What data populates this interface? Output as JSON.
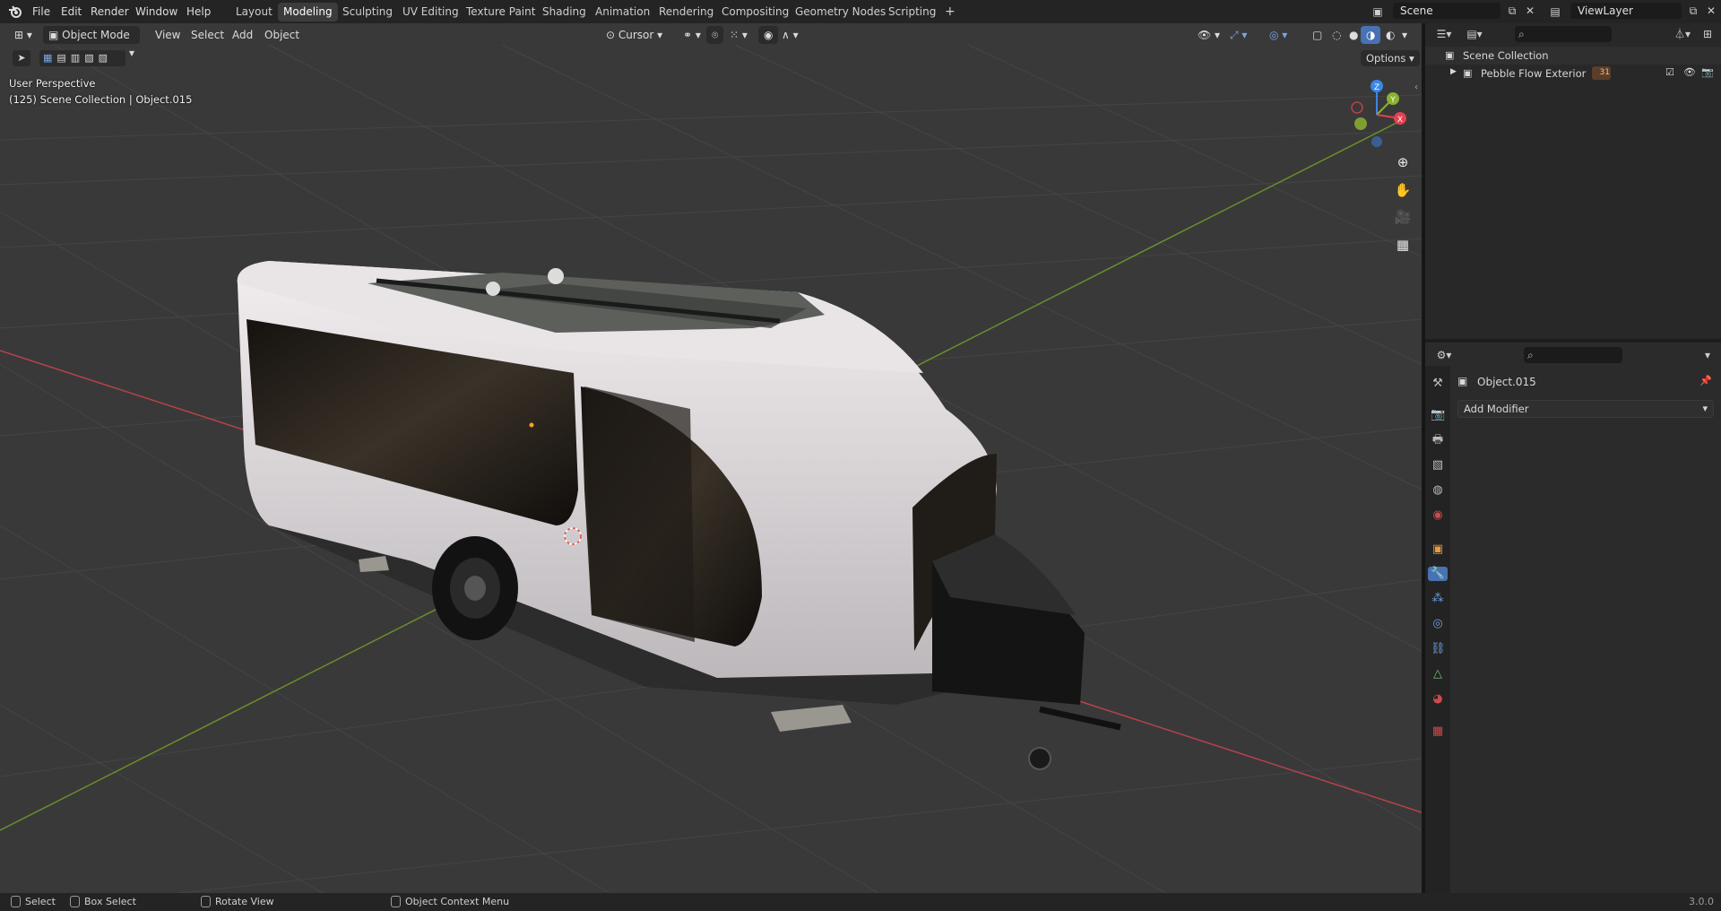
{
  "menubar": {
    "items": [
      "File",
      "Edit",
      "Render",
      "Window",
      "Help"
    ],
    "workspaces": [
      "Layout",
      "Modeling",
      "Sculpting",
      "UV Editing",
      "Texture Paint",
      "Shading",
      "Animation",
      "Rendering",
      "Compositing",
      "Geometry Nodes",
      "Scripting"
    ],
    "active_workspace": "Modeling",
    "add_workspace": "+",
    "scene": "Scene",
    "view_layer": "ViewLayer"
  },
  "viewport_header": {
    "mode": "Object Mode",
    "menus": [
      "View",
      "Select",
      "Add",
      "Object"
    ],
    "pivot": "Cursor",
    "options": "Options"
  },
  "viewport": {
    "perspective": "User Perspective",
    "collection_info": "(125) Scene Collection | Object.015",
    "gizmo": {
      "z": "Z",
      "y": "Y",
      "x": "X"
    }
  },
  "outliner": {
    "root": "Scene Collection",
    "items": [
      {
        "label": "Pebble Flow Exterior",
        "badge": "31"
      }
    ]
  },
  "properties": {
    "object_name": "Object.015",
    "add_modifier": "Add Modifier"
  },
  "statusbar": {
    "select": "Select",
    "box_select": "Box Select",
    "rotate_view": "Rotate View",
    "context_menu": "Object Context Menu",
    "version": "3.0.0"
  },
  "colors": {
    "accent": "#4772b3",
    "axis_x": "#e2424f",
    "axis_y": "#8bb12f",
    "axis_z": "#3c86e6",
    "viewport_bg": "#393939"
  }
}
